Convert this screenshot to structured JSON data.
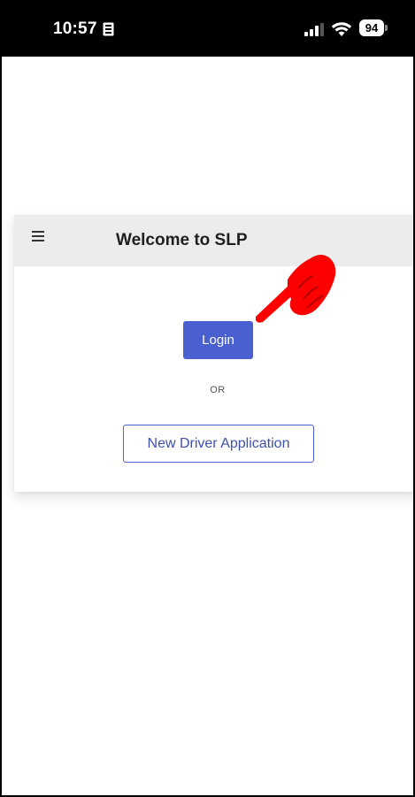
{
  "status_bar": {
    "time": "10:57",
    "battery_level": "94",
    "icons": [
      "id-card-icon",
      "signal-icon",
      "wifi-icon",
      "battery-icon"
    ]
  },
  "header": {
    "menu_icon": "hamburger-menu-icon",
    "title": "Welcome to SLP"
  },
  "main": {
    "login_label": "Login",
    "or_label": "OR",
    "new_driver_label": "New Driver Application"
  },
  "overlay": {
    "pointer_icon": "pointing-hand-icon"
  },
  "colors": {
    "primary": "#4a5fd0",
    "header_bg": "#ececec",
    "status_bar_bg": "#000000",
    "pointer": "#ff0000"
  }
}
